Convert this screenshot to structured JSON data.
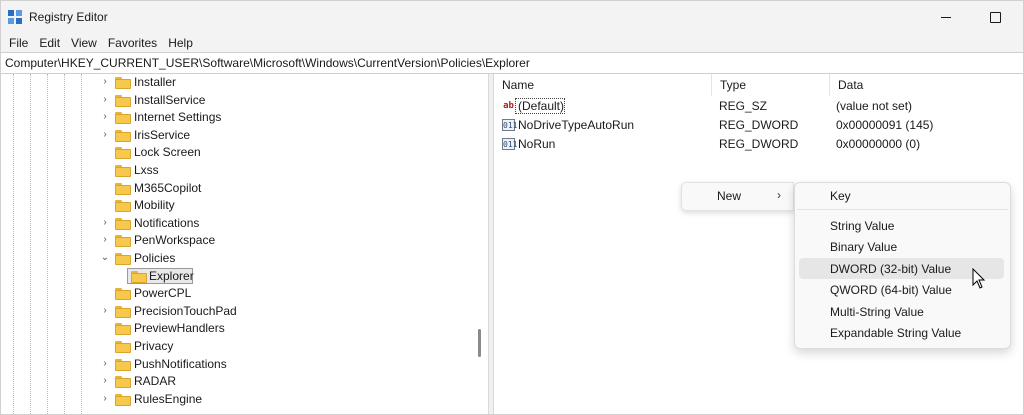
{
  "window": {
    "title": "Registry Editor",
    "icon": "registry-editor-icon"
  },
  "menu": [
    "File",
    "Edit",
    "View",
    "Favorites",
    "Help"
  ],
  "address": "Computer\\HKEY_CURRENT_USER\\Software\\Microsoft\\Windows\\CurrentVersion\\Policies\\Explorer",
  "tree": {
    "items": [
      {
        "label": "Installer",
        "expander": "collapsed"
      },
      {
        "label": "InstallService",
        "expander": "collapsed"
      },
      {
        "label": "Internet Settings",
        "expander": "collapsed"
      },
      {
        "label": "IrisService",
        "expander": "collapsed"
      },
      {
        "label": "Lock Screen",
        "expander": "none"
      },
      {
        "label": "Lxss",
        "expander": "none"
      },
      {
        "label": "M365Copilot",
        "expander": "none"
      },
      {
        "label": "Mobility",
        "expander": "none"
      },
      {
        "label": "Notifications",
        "expander": "collapsed"
      },
      {
        "label": "PenWorkspace",
        "expander": "collapsed"
      },
      {
        "label": "Policies",
        "expander": "expanded"
      },
      {
        "label": "Explorer",
        "expander": "none",
        "child": true,
        "selected": true
      },
      {
        "label": "PowerCPL",
        "expander": "none"
      },
      {
        "label": "PrecisionTouchPad",
        "expander": "collapsed"
      },
      {
        "label": "PreviewHandlers",
        "expander": "none"
      },
      {
        "label": "Privacy",
        "expander": "none"
      },
      {
        "label": "PushNotifications",
        "expander": "collapsed"
      },
      {
        "label": "RADAR",
        "expander": "collapsed"
      },
      {
        "label": "RulesEngine",
        "expander": "collapsed"
      }
    ]
  },
  "list": {
    "columns": {
      "name": "Name",
      "type": "Type",
      "data": "Data"
    },
    "rows": [
      {
        "name": "(Default)",
        "type": "REG_SZ",
        "data": "(value not set)",
        "icon": "ab"
      },
      {
        "name": "NoDriveTypeAutoRun",
        "type": "REG_DWORD",
        "data": "0x00000091 (145)",
        "icon": "011"
      },
      {
        "name": "NoRun",
        "type": "REG_DWORD",
        "data": "0x00000000 (0)",
        "icon": "011"
      }
    ]
  },
  "context_menu": {
    "new_label": "New",
    "submenu": [
      "Key",
      "String Value",
      "Binary Value",
      "DWORD (32-bit) Value",
      "QWORD (64-bit) Value",
      "Multi-String Value",
      "Expandable String Value"
    ],
    "hovered": "DWORD (32-bit) Value"
  },
  "colors": {
    "folder": "#f6c94c",
    "selection": "#e8e8e8",
    "menu_hover": "#e6e6e6"
  }
}
